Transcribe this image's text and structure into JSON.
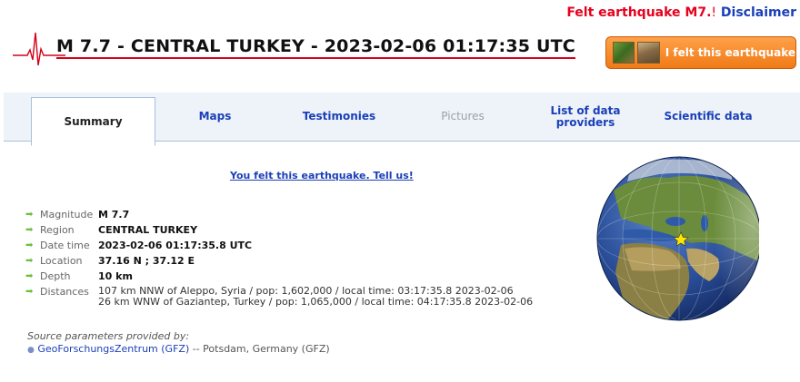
{
  "header": {
    "felt_link": "Felt earthquake M7.",
    "bang": "!",
    "disclaimer": "Disclaimer",
    "title": "M 7.7 - CENTRAL TURKEY - 2023-02-06 01:17:35 UTC",
    "felt_button": "I felt this earthquake"
  },
  "tabs": [
    {
      "label": "Summary",
      "state": "active"
    },
    {
      "label": "Maps",
      "state": "normal"
    },
    {
      "label": "Testimonies",
      "state": "normal"
    },
    {
      "label": "Pictures",
      "state": "disabled"
    },
    {
      "label": "List of data providers",
      "state": "normal"
    },
    {
      "label": "Scientific data",
      "state": "normal"
    }
  ],
  "tell_us": "You felt this earthquake. Tell us!",
  "details": {
    "magnitude": {
      "key": "Magnitude",
      "value": "M 7.7"
    },
    "region": {
      "key": "Region",
      "value": "CENTRAL TURKEY"
    },
    "datetime": {
      "key": "Date time",
      "value": "2023-02-06 01:17:35.8 UTC"
    },
    "location": {
      "key": "Location",
      "value": "37.16 N ; 37.12 E"
    },
    "depth": {
      "key": "Depth",
      "value": "10 km"
    },
    "distances": {
      "key": "Distances",
      "line1": "107 km NNW of Aleppo, Syria / pop: 1,602,000 / local time: 03:17:35.8 2023-02-06",
      "line2": "26 km WNW of Gaziantep, Turkey / pop: 1,065,000 / local time: 04:17:35.8 2023-02-06"
    }
  },
  "source": {
    "label": "Source parameters provided by:",
    "agency_link": "GeoForschungsZentrum (GFZ)",
    "agency_rest": " -- Potsdam, Germany (GFZ)"
  },
  "colors": {
    "accent_red": "#e8001c",
    "link_blue": "#1a3fb8",
    "button_orange": "#f07a16",
    "arrow_green": "#6cbf3a"
  },
  "icons": [
    "seismogram-icon",
    "arrow-right-icon",
    "globe-map-icon",
    "epicenter-star-icon",
    "bullet-icon"
  ]
}
